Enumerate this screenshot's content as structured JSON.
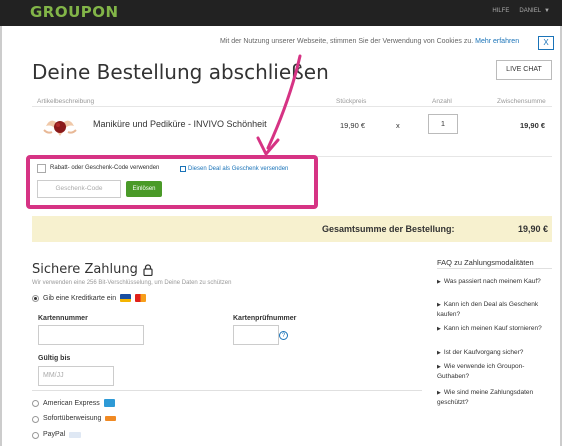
{
  "header": {
    "logo": "GROUPON",
    "help": "HILFE",
    "user": "DANIEL"
  },
  "cookie": {
    "text": "Mit der Nutzung unserer Webseite, stimmen Sie der Verwendung von Cookies zu.",
    "link": "Mehr erfahren",
    "close": "X"
  },
  "page": {
    "title": "Deine Bestellung abschließen",
    "live_chat": "LIVE CHAT"
  },
  "table": {
    "headers": {
      "description": "Artikelbeschreibung",
      "unit_price": "Stückpreis",
      "quantity": "Anzahl",
      "subtotal": "Zwischensumme"
    },
    "row": {
      "name": "Maniküre und Pediküre - INVIVO Schönheit",
      "unit_price": "19,90 €",
      "times": "x",
      "quantity": "1",
      "subtotal": "19,90 €"
    }
  },
  "coupon": {
    "checkbox_label": "Rabatt- oder Geschenk-Code verwenden",
    "gift_link": "Diesen Deal als Geschenk versenden",
    "input_placeholder": "Geschenk-Code",
    "button": "Einlösen"
  },
  "total": {
    "label": "Gesamtsumme der Bestellung:",
    "value": "19,90 €"
  },
  "payment": {
    "title": "Sichere Zahlung",
    "subtitle": "Wir verwenden eine 256 Bit-Verschlüsselung, um Deine Daten zu schützen",
    "credit_card": "Gib eine Kreditkarte ein",
    "card_number_label": "Kartennummer",
    "check_number_label": "Kartenprüfnummer",
    "help": "?",
    "valid_until_label": "Gültig bis",
    "valid_until_placeholder": "MM/JJ",
    "options": [
      "American Express",
      "Sofortüberweisung",
      "PayPal"
    ]
  },
  "faq": {
    "title": "FAQ zu Zahlungsmodalitäten",
    "items": [
      "Was passiert nach meinem Kauf?",
      "Kann ich den Deal als Geschenk kaufen?",
      "Kann ich meinen Kauf stornieren?",
      "Ist der Kaufvorgang sicher?",
      "Wie verwende ich Groupon-Guthaben?",
      "Wie sind meine Zahlungsdaten geschützt?"
    ]
  },
  "colors": {
    "brand": "#82b548",
    "button": "#4a9a28",
    "link": "#1a73b8",
    "highlight": "#d63384",
    "total_bg": "#f7f1cf"
  }
}
